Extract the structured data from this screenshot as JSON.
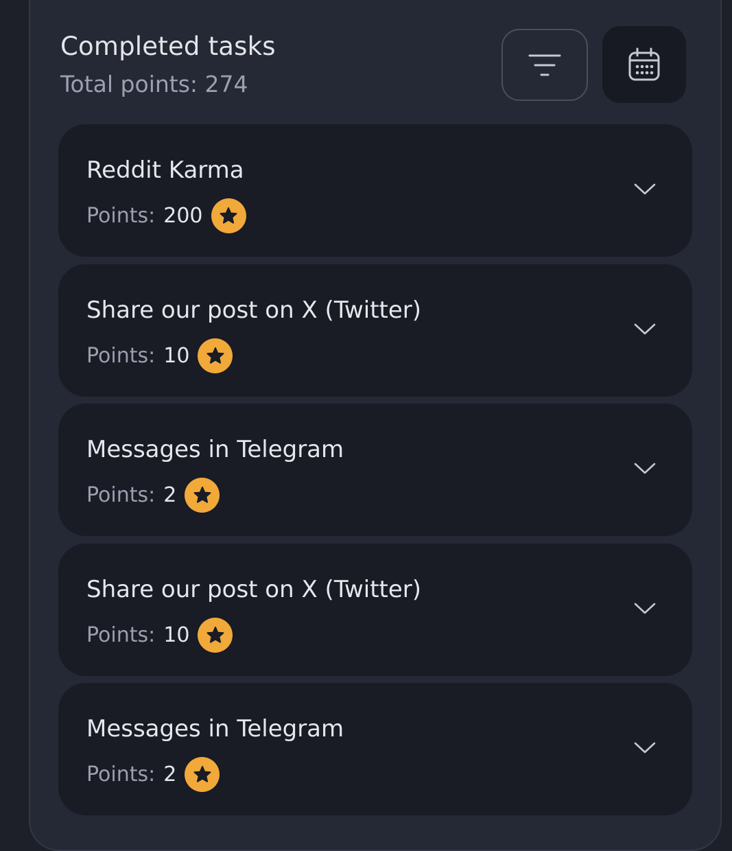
{
  "header": {
    "title": "Completed tasks",
    "total_points": "Total points: 274"
  },
  "toolbar": {
    "filter_icon": "filter-icon",
    "calendar_icon": "calendar-icon"
  },
  "colors": {
    "background": "#1e2029",
    "panel": "#252835",
    "card": "#191b25",
    "star_badge": "#f1a93a"
  },
  "tasks": [
    {
      "title": "Reddit Karma",
      "points_label": "Points:",
      "points": "200",
      "icon": "star-icon"
    },
    {
      "title": "Share our post on X (Twitter)",
      "points_label": "Points:",
      "points": "10",
      "icon": "star-icon"
    },
    {
      "title": "Messages in Telegram",
      "points_label": "Points:",
      "points": "2",
      "icon": "star-icon"
    },
    {
      "title": "Share our post on X (Twitter)",
      "points_label": "Points:",
      "points": "10",
      "icon": "star-icon"
    },
    {
      "title": "Messages in Telegram",
      "points_label": "Points:",
      "points": "2",
      "icon": "star-icon"
    }
  ]
}
